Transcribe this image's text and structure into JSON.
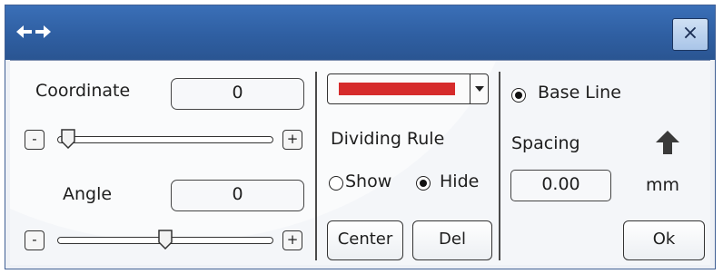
{
  "window": {
    "title_icon": "horizontal-double-arrow-icon",
    "close_label": "×",
    "colors": {
      "titlebar": "#2f5fa2",
      "client": "#f4f6f9"
    }
  },
  "coordinate": {
    "label": "Coordinate",
    "value": "0",
    "minus_label": "-",
    "plus_label": "+",
    "slider_position": 0
  },
  "angle": {
    "label": "Angle",
    "value": "0",
    "minus_label": "-",
    "plus_label": "+",
    "slider_position": 0.5
  },
  "dividing_rule": {
    "color": "#d62b2b",
    "label": "Dividing Rule",
    "show_label": "Show",
    "hide_label": "Hide",
    "selected": "Hide",
    "center_label": "Center",
    "del_label": "Del"
  },
  "base": {
    "baseline_label": "Base Line",
    "baseline_selected": true,
    "spacing_label": "Spacing",
    "spacing_icon": "arrow-up-icon",
    "spacing_value": "0.00",
    "unit": "mm",
    "ok_label": "Ok"
  }
}
